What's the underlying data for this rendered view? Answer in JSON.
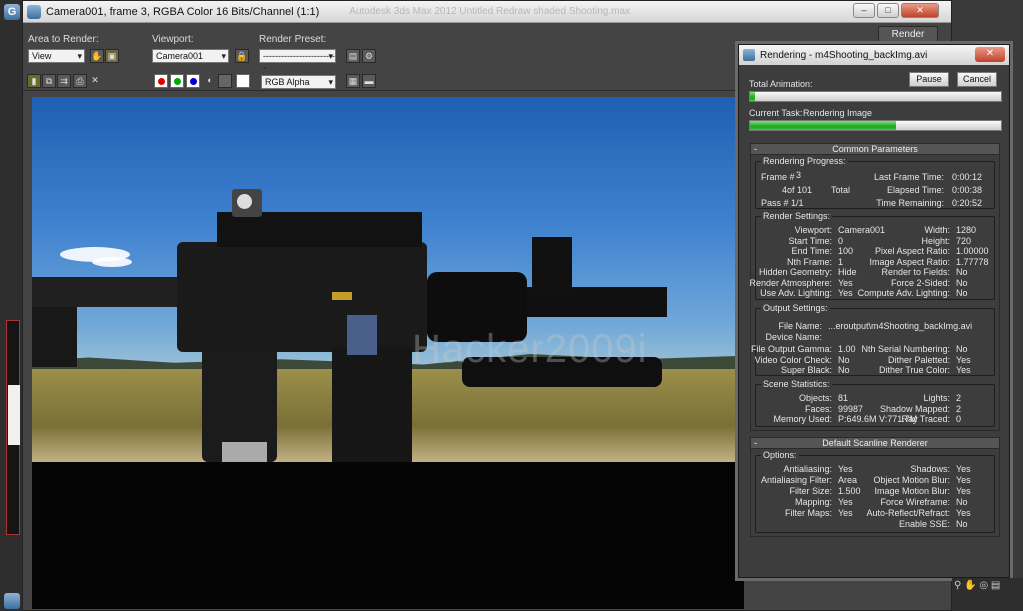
{
  "frame_window": {
    "title": "Camera001, frame 3, RGBA Color 16 Bits/Channel (1:1)",
    "ghost_title": "Autodesk 3ds Max 2012   Untitled   Redraw shaded   Shooting.max",
    "min_label": "–",
    "max_label": "□",
    "close_label": "✕"
  },
  "toolbar": {
    "area_label": "Area to Render:",
    "area_value": "View",
    "viewport_label": "Viewport:",
    "viewport_value": "Camera001",
    "preset_label": "Render Preset:",
    "preset_value": "-------------------------",
    "render_button": "Render",
    "channel_value": "RGB Alpha"
  },
  "viewport": {
    "watermark": "Hacker2009i"
  },
  "dialog": {
    "title": "Rendering - m4Shooting_backImg.avi",
    "close_label": "✕",
    "pause": "Pause",
    "cancel": "Cancel",
    "total_animation_label": "Total Animation:",
    "total_progress": 0.02,
    "current_task_label": "Current Task:",
    "current_task_value": "Rendering Image",
    "task_progress": 0.58,
    "common_params_header": "Common Parameters",
    "scanline_header": "Default Scanline Renderer",
    "progress": {
      "title": "Rendering Progress:",
      "frame_label": "Frame #",
      "frame_value": "3",
      "of_line": "4of 101",
      "total_label": "Total",
      "pass_line": "Pass #  1/1",
      "last_frame_label": "Last Frame Time:",
      "last_frame_value": "0:00:12",
      "elapsed_label": "Elapsed Time:",
      "elapsed_value": "0:00:38",
      "remaining_label": "Time Remaining:",
      "remaining_value": "0:20:52"
    },
    "render_settings": {
      "title": "Render Settings:",
      "left": [
        {
          "k": "Viewport:",
          "v": "Camera001"
        },
        {
          "k": "Start Time:",
          "v": "0"
        },
        {
          "k": "End Time:",
          "v": "100"
        },
        {
          "k": "Nth Frame:",
          "v": "1"
        },
        {
          "k": "Hidden Geometry:",
          "v": "Hide"
        },
        {
          "k": "Render Atmosphere:",
          "v": "Yes"
        },
        {
          "k": "Use Adv. Lighting:",
          "v": "Yes"
        }
      ],
      "right": [
        {
          "k": "Width:",
          "v": "1280"
        },
        {
          "k": "Height:",
          "v": "720"
        },
        {
          "k": "Pixel Aspect Ratio:",
          "v": "1.00000"
        },
        {
          "k": "Image Aspect Ratio:",
          "v": "1.77778"
        },
        {
          "k": "Render to Fields:",
          "v": "No"
        },
        {
          "k": "Force 2-Sided:",
          "v": "No"
        },
        {
          "k": "Compute Adv. Lighting:",
          "v": "No"
        }
      ]
    },
    "output_settings": {
      "title": "Output Settings:",
      "file_name_label": "File Name:",
      "file_name_value": "...eroutput\\m4Shooting_backImg.avi",
      "device_name_label": "Device Name:",
      "left": [
        {
          "k": "File Output Gamma:",
          "v": "1.00"
        },
        {
          "k": "Video Color Check:",
          "v": "No"
        },
        {
          "k": "Super Black:",
          "v": "No"
        }
      ],
      "right": [
        {
          "k": "Nth Serial Numbering:",
          "v": "No"
        },
        {
          "k": "Dither Paletted:",
          "v": "Yes"
        },
        {
          "k": "Dither True Color:",
          "v": "Yes"
        }
      ]
    },
    "scene_stats": {
      "title": "Scene Statistics:",
      "left": [
        {
          "k": "Objects:",
          "v": "81"
        },
        {
          "k": "Faces:",
          "v": "99987"
        },
        {
          "k": "Memory Used:",
          "v": "P:649.6M V:771.7M"
        }
      ],
      "right": [
        {
          "k": "Lights:",
          "v": "2"
        },
        {
          "k": "Shadow Mapped:",
          "v": "2"
        },
        {
          "k": "Ray Traced:",
          "v": "0"
        }
      ]
    },
    "options": {
      "title": "Options:",
      "left": [
        {
          "k": "Antialiasing:",
          "v": "Yes"
        },
        {
          "k": "Antialiasing Filter:",
          "v": "Area"
        },
        {
          "k": "Filter Size:",
          "v": "1.500"
        },
        {
          "k": "Mapping:",
          "v": "Yes"
        },
        {
          "k": "Filter Maps:",
          "v": "Yes"
        }
      ],
      "right": [
        {
          "k": "Shadows:",
          "v": "Yes"
        },
        {
          "k": "Object Motion Blur:",
          "v": "Yes"
        },
        {
          "k": "Image Motion Blur:",
          "v": "Yes"
        },
        {
          "k": "Force Wireframe:",
          "v": "No"
        },
        {
          "k": "Auto-Reflect/Refract:",
          "v": "Yes"
        },
        {
          "k": "Enable SSE:",
          "v": "No"
        }
      ]
    }
  }
}
